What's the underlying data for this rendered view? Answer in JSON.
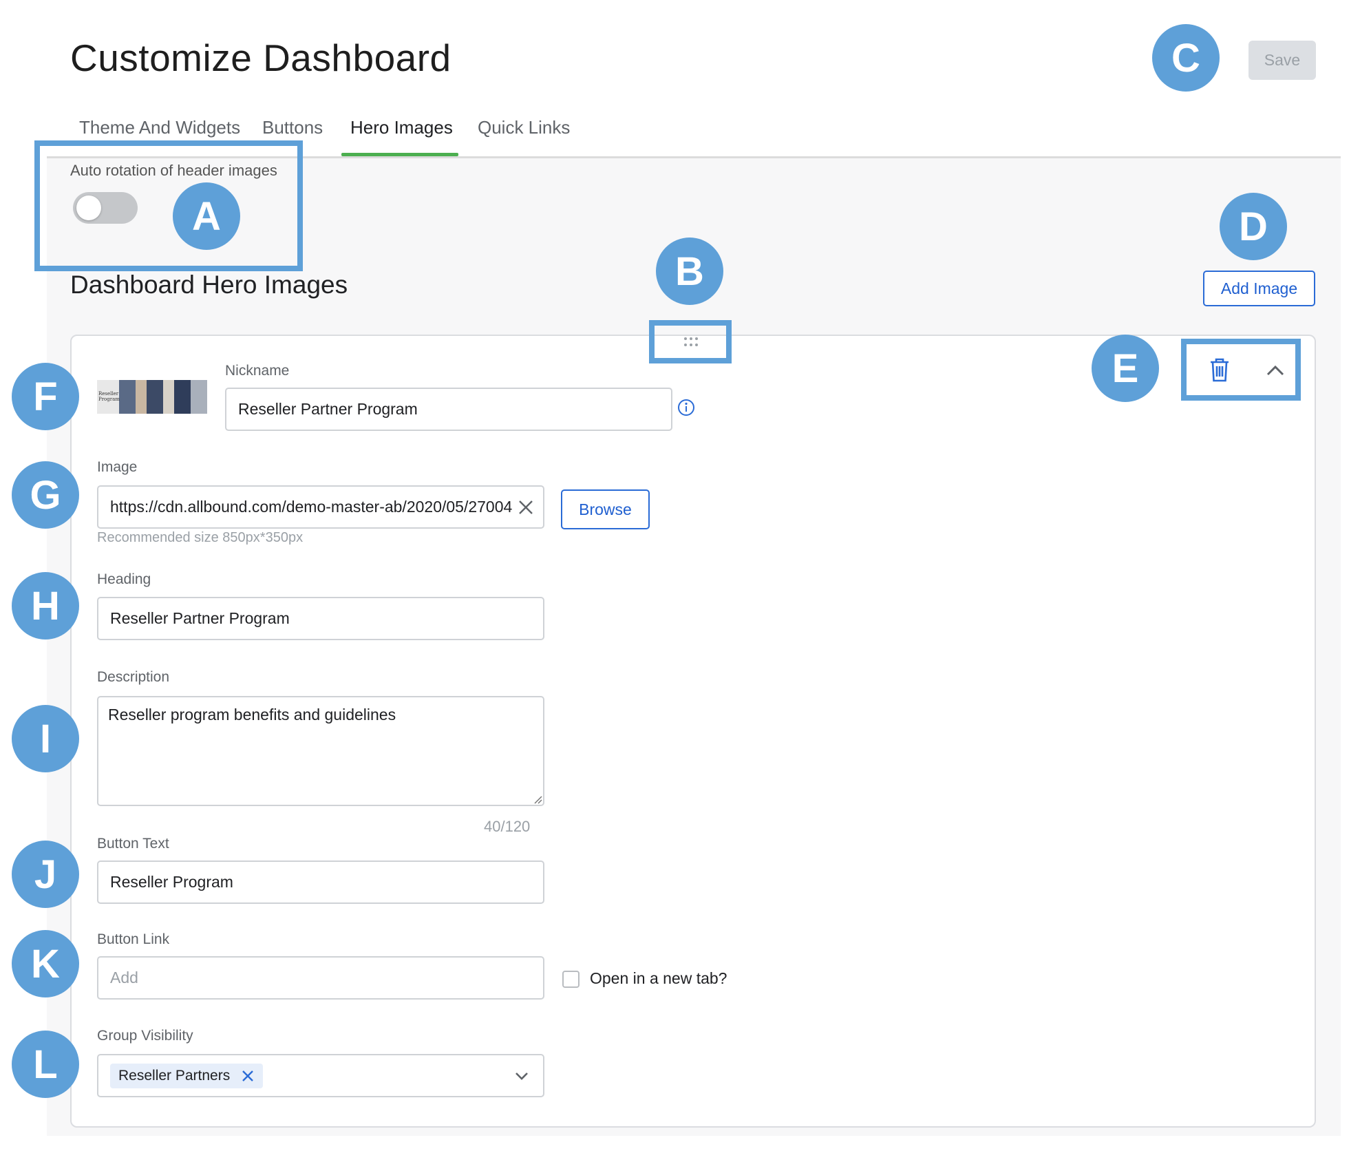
{
  "page": {
    "title": "Customize Dashboard",
    "save_label": "Save"
  },
  "tabs": [
    {
      "label": "Theme And Widgets",
      "active": false
    },
    {
      "label": "Buttons",
      "active": false
    },
    {
      "label": "Hero Images",
      "active": true
    },
    {
      "label": "Quick Links",
      "active": false
    }
  ],
  "rotation": {
    "label": "Auto rotation of header images",
    "enabled": false
  },
  "section": {
    "title": "Dashboard Hero Images",
    "add_label": "Add Image"
  },
  "card": {
    "thumbnail_caption": "Reseller Program",
    "nickname": {
      "label": "Nickname",
      "value": "Reseller Partner Program"
    },
    "image": {
      "label": "Image",
      "value": "https://cdn.allbound.com/demo-master-ab/2020/05/27004",
      "browse_label": "Browse",
      "hint": "Recommended size 850px*350px"
    },
    "heading": {
      "label": "Heading",
      "value": "Reseller Partner Program"
    },
    "description": {
      "label": "Description",
      "value": "Reseller program benefits and guidelines",
      "count": "40/120"
    },
    "button_text": {
      "label": "Button Text",
      "value": "Reseller Program"
    },
    "button_link": {
      "label": "Button Link",
      "placeholder": "Add",
      "new_tab_label": "Open in a new tab?",
      "new_tab_checked": false
    },
    "group_visibility": {
      "label": "Group Visibility",
      "selected": [
        "Reseller Partners"
      ]
    }
  },
  "callouts": [
    "A",
    "B",
    "C",
    "D",
    "E",
    "F",
    "G",
    "H",
    "I",
    "J",
    "K",
    "L"
  ],
  "colors": {
    "accent": "#2a6bd6",
    "tab_indicator": "#4caf50",
    "callout": "#5ea0d8",
    "disabled_button": "#dcdfe3"
  }
}
